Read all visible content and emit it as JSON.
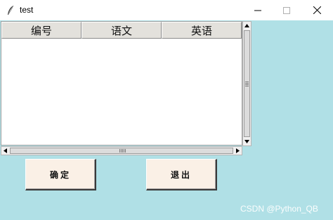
{
  "window": {
    "title": "test",
    "controls": {
      "minimize": "minimize-icon",
      "maximize": "maximize-icon",
      "close": "close-icon"
    }
  },
  "table": {
    "columns": [
      "编号",
      "语文",
      "英语"
    ],
    "rows": []
  },
  "buttons": {
    "confirm": "确定",
    "exit": "退出"
  },
  "watermark": "CSDN @Python_QB",
  "colors": {
    "background": "#b0e0e6",
    "button_bg": "#faf0e6",
    "header_bg": "#e3e1dc"
  }
}
